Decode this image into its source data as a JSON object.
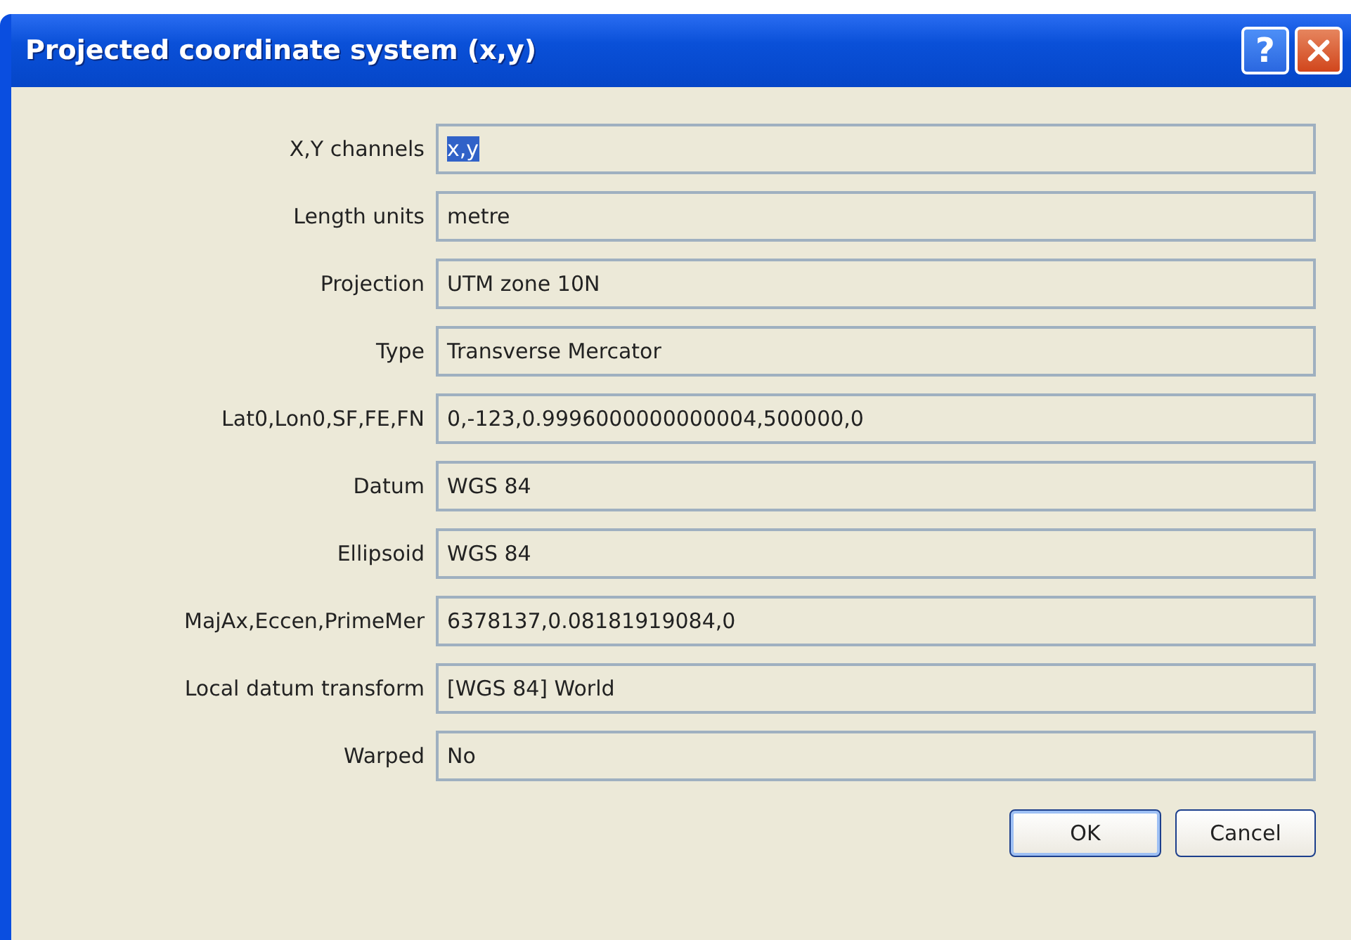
{
  "window": {
    "title": "Projected coordinate system (x,y)",
    "help_button": "?"
  },
  "fields": [
    {
      "label": "X,Y channels",
      "value": "x,y",
      "selected": true
    },
    {
      "label": "Length units",
      "value": "metre",
      "selected": false
    },
    {
      "label": "Projection",
      "value": "UTM zone 10N",
      "selected": false
    },
    {
      "label": "Type",
      "value": "Transverse Mercator",
      "selected": false
    },
    {
      "label": "Lat0,Lon0,SF,FE,FN",
      "value": "0,-123,0.9996000000000004,500000,0",
      "selected": false
    },
    {
      "label": "Datum",
      "value": "WGS 84",
      "selected": false
    },
    {
      "label": "Ellipsoid",
      "value": "WGS 84",
      "selected": false
    },
    {
      "label": "MajAx,Eccen,PrimeMer",
      "value": "6378137,0.08181919084,0",
      "selected": false
    },
    {
      "label": "Local datum transform",
      "value": "[WGS 84] World",
      "selected": false
    },
    {
      "label": "Warped",
      "value": "No",
      "selected": false
    }
  ],
  "buttons": [
    "OK",
    "Cancel"
  ]
}
